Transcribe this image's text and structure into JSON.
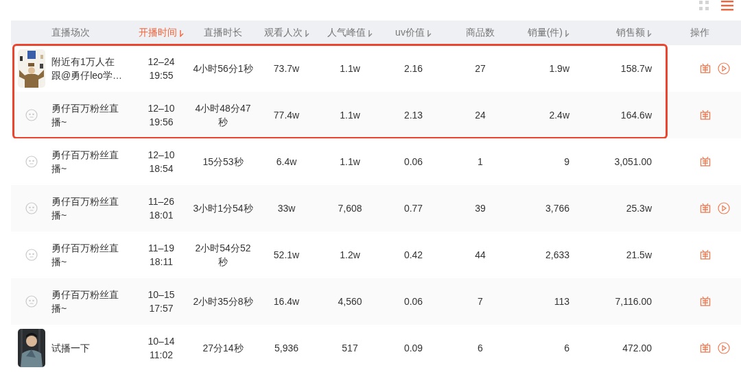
{
  "view_toggle": [
    {
      "kind": "grid",
      "selected": false
    },
    {
      "kind": "list",
      "selected": true
    }
  ],
  "table": {
    "columns": [
      {
        "label": "直播场次",
        "sortable": false,
        "selected": false
      },
      {
        "label": "开播时间",
        "sortable": true,
        "selected": true
      },
      {
        "label": "直播时长",
        "sortable": false,
        "selected": false
      },
      {
        "label": "观看人次",
        "sortable": true,
        "selected": false
      },
      {
        "label": "人气峰值",
        "sortable": true,
        "selected": false
      },
      {
        "label": "uv价值",
        "sortable": true,
        "selected": false
      },
      {
        "label": "商品数",
        "sortable": false,
        "selected": false
      },
      {
        "label": "销量(件)",
        "sortable": true,
        "selected": false
      },
      {
        "label": "销售额",
        "sortable": true,
        "selected": false
      },
      {
        "label": "操作",
        "sortable": false,
        "selected": false
      }
    ],
    "rows": [
      {
        "kind": "picture",
        "highlighted": true,
        "title": "附近有1万人在跟@勇仔leo学…",
        "date": "12–24",
        "time": "19:55",
        "duration": "4小时56分1秒",
        "views": "73.7w",
        "peak": "1.1w",
        "uv": "2.16",
        "products": "27",
        "sales": "1.9w",
        "revenue": "158.7w",
        "replay": true
      },
      {
        "kind": "placeholder",
        "highlighted": true,
        "title": "勇仔百万粉丝直播~",
        "date": "12–10",
        "time": "19:56",
        "duration": "4小时48分47秒",
        "views": "77.4w",
        "peak": "1.1w",
        "uv": "2.13",
        "products": "24",
        "sales": "2.4w",
        "revenue": "164.6w",
        "replay": false
      },
      {
        "kind": "placeholder",
        "highlighted": false,
        "title": "勇仔百万粉丝直播~",
        "date": "12–10",
        "time": "18:54",
        "duration": "15分53秒",
        "views": "6.4w",
        "peak": "1.1w",
        "uv": "0.06",
        "products": "1",
        "sales": "9",
        "revenue": "3,051.00",
        "replay": false
      },
      {
        "kind": "placeholder",
        "highlighted": false,
        "title": "勇仔百万粉丝直播~",
        "date": "11–26",
        "time": "18:01",
        "duration": "3小时1分54秒",
        "views": "33w",
        "peak": "7,608",
        "uv": "0.77",
        "products": "39",
        "sales": "3,766",
        "revenue": "25.3w",
        "replay": true
      },
      {
        "kind": "placeholder",
        "highlighted": false,
        "title": "勇仔百万粉丝直播~",
        "date": "11–19",
        "time": "18:11",
        "duration": "2小时54分52秒",
        "views": "52.1w",
        "peak": "1.2w",
        "uv": "0.42",
        "products": "44",
        "sales": "2,633",
        "revenue": "21.5w",
        "replay": false
      },
      {
        "kind": "placeholder",
        "highlighted": false,
        "title": "勇仔百万粉丝直播~",
        "date": "10–15",
        "time": "17:57",
        "duration": "2小时35分8秒",
        "views": "16.4w",
        "peak": "4,560",
        "uv": "0.06",
        "products": "7",
        "sales": "113",
        "revenue": "7,116.00",
        "replay": false
      },
      {
        "kind": "picture",
        "highlighted": false,
        "title": "试播一下",
        "date": "10–14",
        "time": "11:02",
        "duration": "27分14秒",
        "views": "5,936",
        "peak": "517",
        "uv": "0.09",
        "products": "6",
        "sales": "6",
        "revenue": "472.00",
        "replay": true
      }
    ]
  }
}
